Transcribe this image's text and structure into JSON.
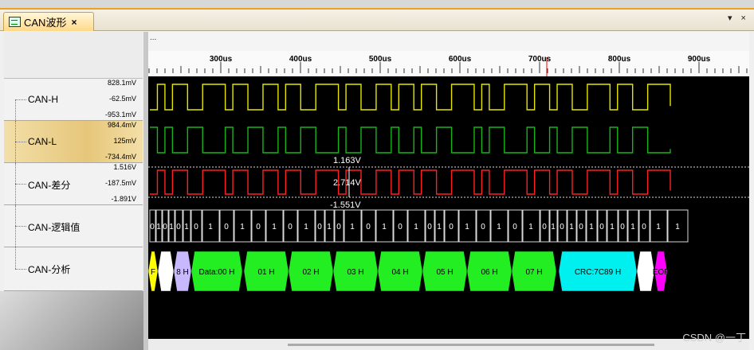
{
  "tab": {
    "title": "CAN波形",
    "close": "×"
  },
  "window_controls": "▾ ×",
  "ruler": {
    "menu": "...",
    "labels": [
      "300us",
      "400us",
      "500us",
      "600us",
      "700us",
      "800us",
      "900us"
    ]
  },
  "channels": [
    {
      "name": "CAN-H",
      "scale_top": "828.1mV",
      "scale_mid": "-62.5mV",
      "scale_bot": "-953.1mV"
    },
    {
      "name": "CAN-L",
      "scale_top": "984.4mV",
      "scale_mid": "125mV",
      "scale_bot": "-734.4mV"
    },
    {
      "name": "CAN-差分",
      "scale_top": "1.516V",
      "scale_mid": "-187.5mV",
      "scale_bot": "-1.891V"
    },
    {
      "name": "CAN-逻辑值"
    },
    {
      "name": "CAN-分析"
    }
  ],
  "measurements": {
    "upper": "1.163V",
    "delta": "2.714V",
    "lower": "-1.551V"
  },
  "logic_bits": [
    "0",
    "1",
    "0",
    "1",
    "0",
    "1",
    "0",
    "1",
    "0",
    "1",
    "0",
    "1",
    "0",
    "1",
    "0",
    "1",
    "0",
    "1",
    "0",
    "1",
    "0",
    "1",
    "0",
    "1",
    "0",
    "1",
    "0",
    "1",
    "0",
    "1",
    "0",
    "1",
    "0",
    "1",
    "0",
    "1",
    "0",
    "1",
    "0",
    "1",
    "0",
    "1",
    "1"
  ],
  "frame_fields": [
    {
      "label": "F",
      "color": "#ffff00"
    },
    {
      "label": "",
      "color": "#ffffff"
    },
    {
      "label": "8 H",
      "color": "#c8b8ff"
    },
    {
      "label": "Data:00 H",
      "color": "#22ee22"
    },
    {
      "label": "01 H",
      "color": "#22ee22"
    },
    {
      "label": "02 H",
      "color": "#22ee22"
    },
    {
      "label": "03 H",
      "color": "#22ee22"
    },
    {
      "label": "04 H",
      "color": "#22ee22"
    },
    {
      "label": "05 H",
      "color": "#22ee22"
    },
    {
      "label": "06 H",
      "color": "#22ee22"
    },
    {
      "label": "07 H",
      "color": "#22ee22"
    },
    {
      "label": "CRC:7C89 H",
      "color": "#00f0f0"
    },
    {
      "label": "",
      "color": "#ffffff"
    },
    {
      "label": "EOF",
      "color": "#ff00ff"
    }
  ],
  "colors": {
    "can_h": "#e6e600",
    "can_l": "#19b419",
    "can_diff": "#ff2020",
    "logic": "#d8d8d8",
    "cursor": "#ff0000"
  },
  "watermark": "CSDN @一丁"
}
